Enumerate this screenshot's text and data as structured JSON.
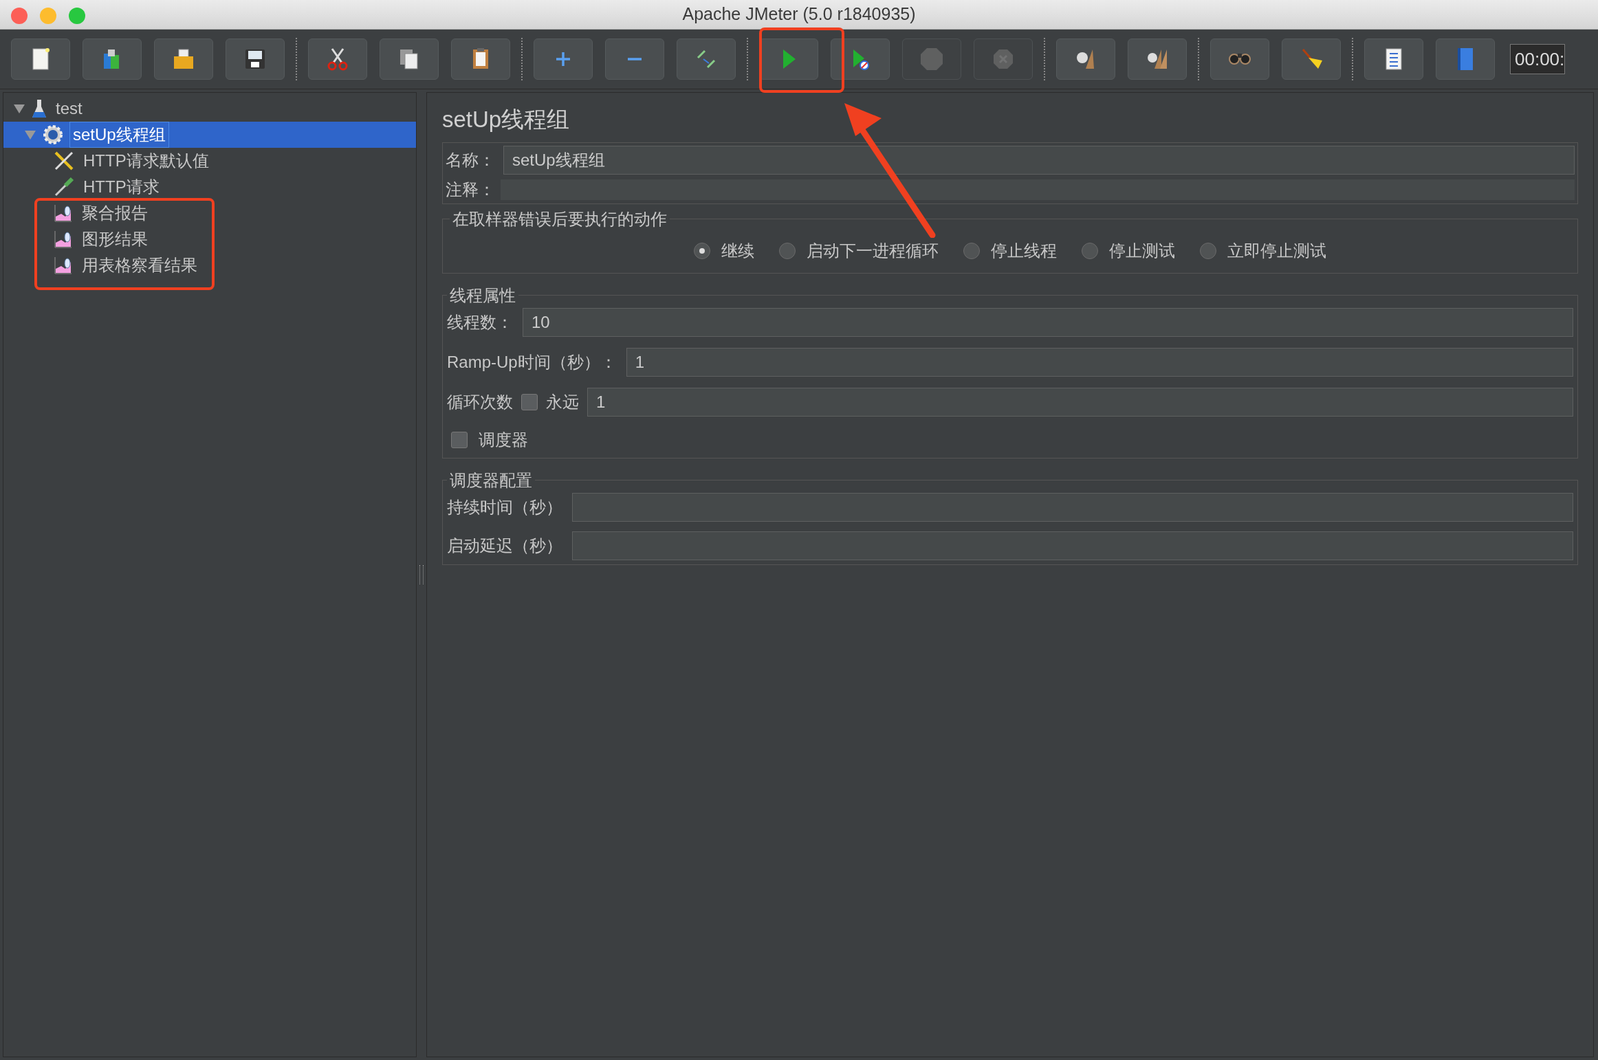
{
  "window": {
    "title": "Apache JMeter (5.0 r1840935)"
  },
  "toolbar": {
    "groups": [
      [
        {
          "kind": "new",
          "disabled": false
        },
        {
          "kind": "templates",
          "disabled": false
        },
        {
          "kind": "open",
          "disabled": false
        },
        {
          "kind": "save",
          "disabled": false
        }
      ],
      [
        {
          "kind": "cut",
          "disabled": false
        },
        {
          "kind": "copy",
          "disabled": false
        },
        {
          "kind": "paste",
          "disabled": false
        }
      ],
      [
        {
          "kind": "expand",
          "disabled": false
        },
        {
          "kind": "collapse",
          "disabled": false
        },
        {
          "kind": "toggle",
          "disabled": false
        }
      ],
      [
        {
          "kind": "start",
          "disabled": false
        },
        {
          "kind": "start_no_timers",
          "disabled": false
        },
        {
          "kind": "stop",
          "disabled": true
        },
        {
          "kind": "shutdown",
          "disabled": true
        }
      ],
      [
        {
          "kind": "clear",
          "disabled": false
        },
        {
          "kind": "clear_all",
          "disabled": false
        }
      ],
      [
        {
          "kind": "search",
          "disabled": false
        },
        {
          "kind": "reset_search",
          "disabled": false
        }
      ],
      [
        {
          "kind": "function_helper",
          "disabled": false
        },
        {
          "kind": "help",
          "disabled": false
        }
      ]
    ],
    "timer": "00:00:"
  },
  "tree": [
    {
      "label": "test",
      "kind": "plan",
      "expanded": true,
      "selected": false,
      "children": [
        {
          "label": "setUp线程组",
          "kind": "thread_group",
          "expanded": true,
          "selected": true,
          "children": [
            {
              "label": "HTTP请求默认值",
              "kind": "config",
              "selected": false
            },
            {
              "label": "HTTP请求",
              "kind": "sampler",
              "selected": false
            },
            {
              "label": "聚合报告",
              "kind": "listener",
              "selected": false
            },
            {
              "label": "图形结果",
              "kind": "listener",
              "selected": false
            },
            {
              "label": "用表格察看结果",
              "kind": "listener",
              "selected": false
            }
          ]
        }
      ]
    }
  ],
  "editor": {
    "title": "setUp线程组",
    "name_label": "名称：",
    "name_value": "setUp线程组",
    "comment_label": "注释：",
    "error_action": {
      "legend": "在取样器错误后要执行的动作",
      "options": [
        {
          "label": "继续",
          "selected": true
        },
        {
          "label": "启动下一进程循环",
          "selected": false
        },
        {
          "label": "停止线程",
          "selected": false
        },
        {
          "label": "停止测试",
          "selected": false
        },
        {
          "label": "立即停止测试",
          "selected": false
        }
      ]
    },
    "thread_properties": {
      "legend": "线程属性",
      "fields": [
        {
          "label": "线程数：",
          "value": "10"
        },
        {
          "label": "Ramp-Up时间（秒）：",
          "value": "1"
        }
      ],
      "loop": {
        "label": "循环次数",
        "forever_label": "永远",
        "forever_checked": false,
        "value": "1"
      },
      "scheduler": {
        "label": "调度器",
        "checked": false
      }
    },
    "scheduler_config": {
      "legend": "调度器配置",
      "fields": [
        {
          "label": "持续时间（秒）"
        },
        {
          "label": "启动延迟（秒）"
        }
      ]
    }
  }
}
